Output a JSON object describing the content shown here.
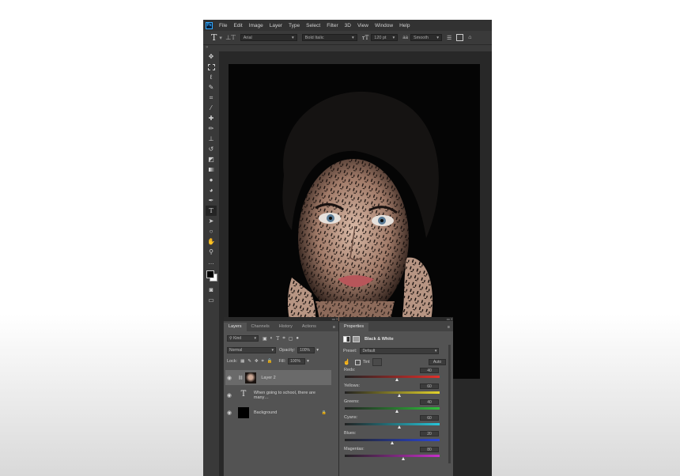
{
  "menu": [
    "File",
    "Edit",
    "Image",
    "Layer",
    "Type",
    "Select",
    "Filter",
    "3D",
    "View",
    "Window",
    "Help"
  ],
  "options": {
    "font_family": "Arial",
    "font_style": "Bold Italic",
    "font_size": "120 pt",
    "antialias_label": "aa",
    "antialias": "Smooth"
  },
  "layers_panel": {
    "tabs": [
      "Layers",
      "Channels",
      "History",
      "Actions"
    ],
    "filter_kind": "Kind",
    "blend_mode": "Normal",
    "opacity_label": "Opacity:",
    "opacity": "100%",
    "lock_label": "Lock:",
    "fill_label": "Fill:",
    "fill": "100%",
    "layers": [
      {
        "name": "Layer 2",
        "selected": true
      },
      {
        "name": "When going to school, there are many…",
        "selected": false
      },
      {
        "name": "Background",
        "selected": false
      }
    ]
  },
  "properties_panel": {
    "tab": "Properties",
    "adjustment_title": "Black & White",
    "preset_label": "Preset:",
    "preset": "Default",
    "tint_label": "Tint",
    "auto_label": "Auto",
    "sliders": [
      {
        "label": "Reds:",
        "value": "40",
        "pos": 0.55
      },
      {
        "label": "Yellows:",
        "value": "60",
        "pos": 0.58
      },
      {
        "label": "Greens:",
        "value": "40",
        "pos": 0.55
      },
      {
        "label": "Cyans:",
        "value": "60",
        "pos": 0.58
      },
      {
        "label": "Blues:",
        "value": "20",
        "pos": 0.5
      },
      {
        "label": "Magentas:",
        "value": "80",
        "pos": 0.62
      }
    ]
  },
  "colors": {
    "foreground": "#000000",
    "background": "#ffffff",
    "accent": "#31a8ff"
  }
}
